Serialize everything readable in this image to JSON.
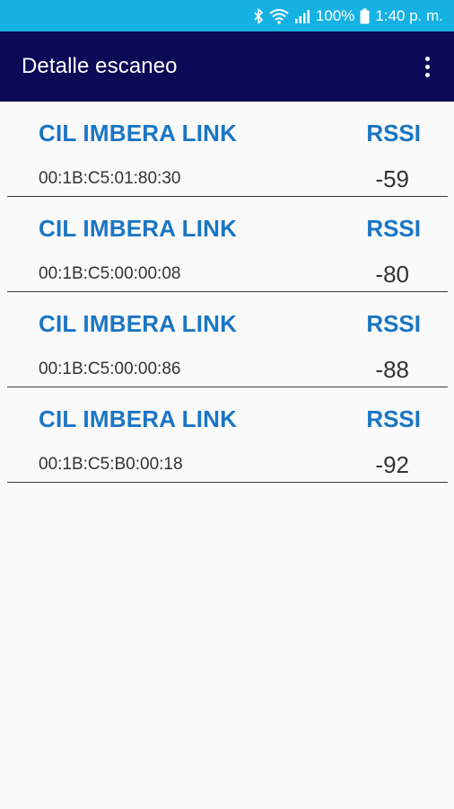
{
  "status_bar": {
    "bluetooth_icon": "bluetooth-icon",
    "wifi_icon": "wifi-icon",
    "signal_icon": "signal-icon",
    "battery_text": "100%",
    "battery_icon": "battery-icon",
    "time": "1:40 p. m."
  },
  "app_bar": {
    "title": "Detalle escaneo",
    "menu_icon": "overflow-menu-icon"
  },
  "devices": [
    {
      "name": "CIL IMBERA LINK",
      "rssi_label": "RSSI",
      "mac": "00:1B:C5:01:80:30",
      "rssi": "-59"
    },
    {
      "name": "CIL IMBERA LINK",
      "rssi_label": "RSSI",
      "mac": "00:1B:C5:00:00:08",
      "rssi": "-80"
    },
    {
      "name": "CIL IMBERA LINK",
      "rssi_label": "RSSI",
      "mac": "00:1B:C5:00:00:86",
      "rssi": "-88"
    },
    {
      "name": "CIL IMBERA LINK",
      "rssi_label": "RSSI",
      "mac": "00:1B:C5:B0:00:18",
      "rssi": "-92"
    }
  ],
  "colors": {
    "status_bar": "#16b1e3",
    "app_bar": "#0c0a57",
    "accent_text": "#1a75c4",
    "background": "#fafafa"
  }
}
